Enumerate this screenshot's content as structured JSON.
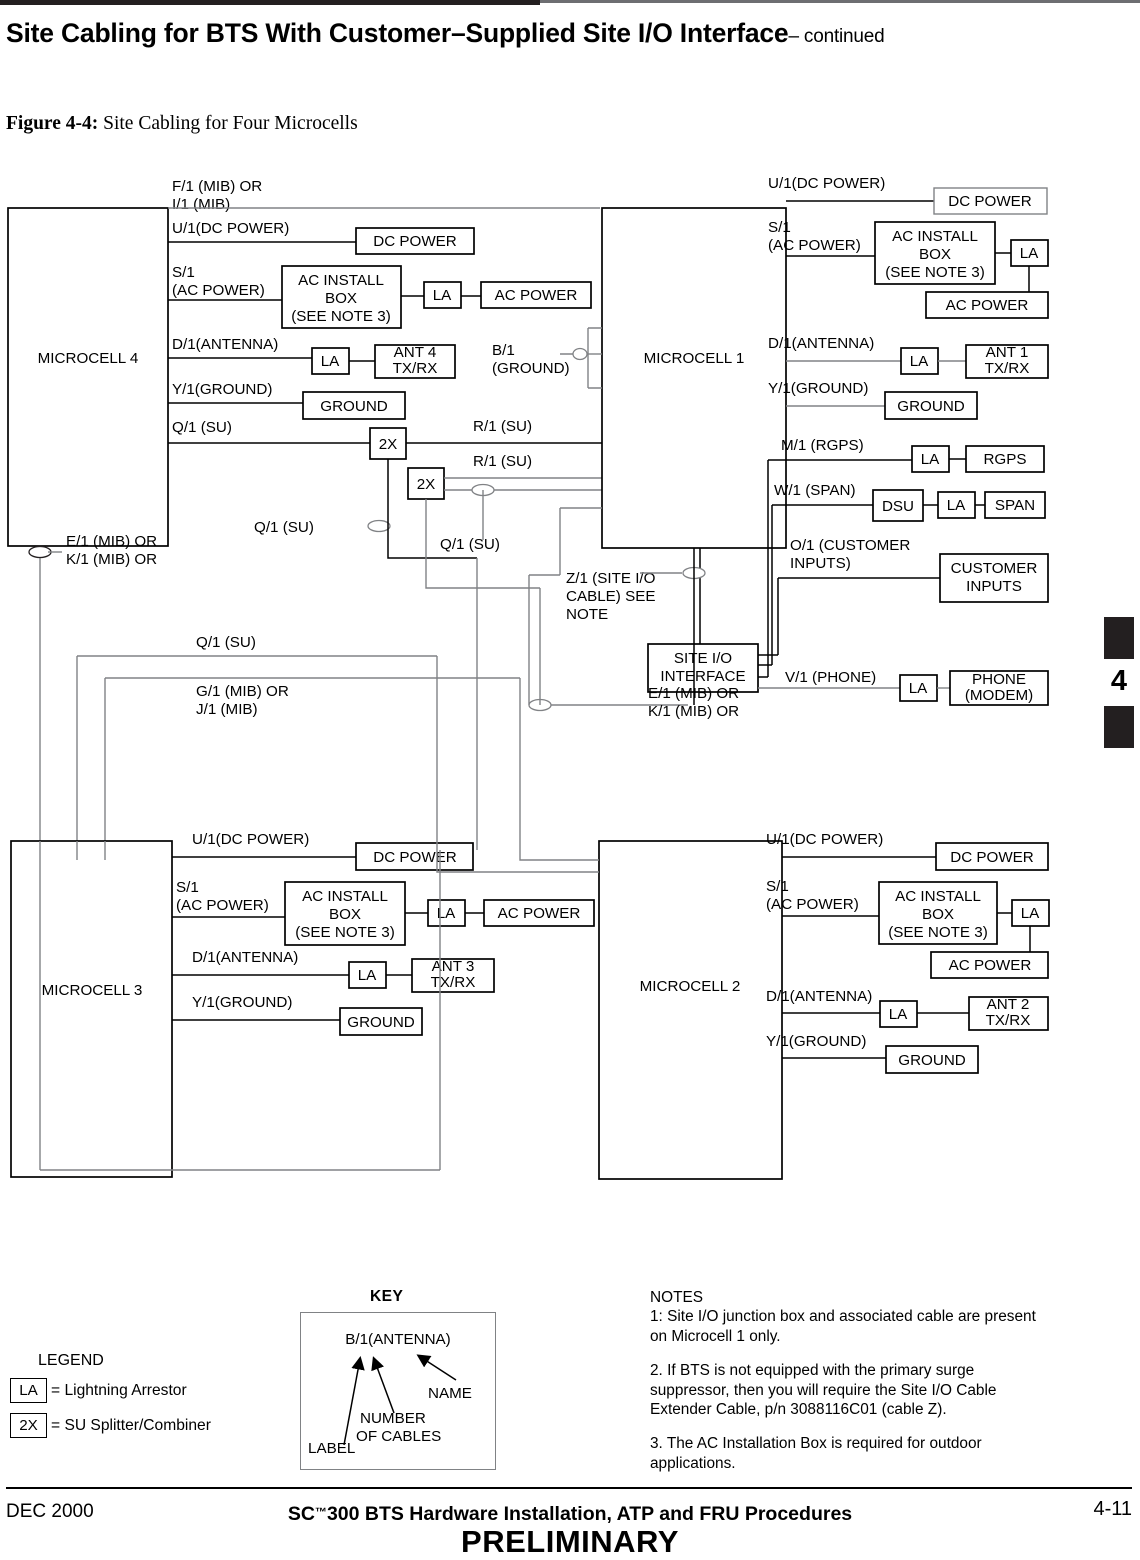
{
  "header": {
    "running_head": "Site Cabling for BTS With Customer–Supplied Site I/O Interface",
    "running_head_continued": "– continued"
  },
  "figure": {
    "number": "Figure 4-4:",
    "title": "Site Cabling for Four Microcells"
  },
  "chapter_tab": {
    "number": "4"
  },
  "diagram": {
    "microcell4": {
      "title": "MICROCELL 4",
      "top_label_line1": "F/1 (MIB) OR",
      "top_label_line2": "I/1 (MIB)",
      "bottom_label_line1": "E/1 (MIB) OR",
      "bottom_label_line2": "K/1 (MIB) OR",
      "ports": [
        {
          "label": "U/1(DC POWER)",
          "target": "DC POWER"
        },
        {
          "label_line1": "S/1",
          "label_line2": "(AC POWER)",
          "target": "AC INSTALL BOX (SEE NOTE 3)",
          "arrestor": "LA",
          "target2": "AC POWER"
        },
        {
          "label": "D/1(ANTENNA)",
          "arrestor": "LA",
          "target": "ANT 4 TX/RX"
        },
        {
          "label": "Y/1(GROUND)",
          "target": "GROUND"
        },
        {
          "label": "Q/1 (SU)",
          "splitter": "2X"
        }
      ],
      "ac_install_box_line1": "AC INSTALL",
      "ac_install_box_line2": "BOX",
      "ac_install_box_line3": "(SEE NOTE 3)",
      "ant_line1": "ANT 4",
      "ant_line2": "TX/RX"
    },
    "microcell1": {
      "title": "MICROCELL 1",
      "ports": [
        {
          "label": "U/1(DC POWER)",
          "target": "DC POWER"
        },
        {
          "label_line1": "S/1",
          "label_line2": "(AC POWER)",
          "target": "AC INSTALL BOX (SEE NOTE 3)",
          "arrestor": "LA",
          "target2": "AC POWER"
        },
        {
          "label": "D/1(ANTENNA)",
          "arrestor": "LA",
          "target": "ANT 1 TX/RX"
        },
        {
          "label": "Y/1(GROUND)",
          "target": "GROUND"
        },
        {
          "label": "M/1 (RGPS)",
          "arrestor": "LA",
          "target": "RGPS"
        },
        {
          "label": "W/1 (SPAN)",
          "dsu": "DSU",
          "arrestor": "LA",
          "target": "SPAN"
        },
        {
          "label_line1": "O/1 (CUSTOMER",
          "label_line2": "INPUTS)",
          "target": "CUSTOMER INPUTS"
        },
        {
          "label": "V/1 (PHONE)",
          "arrestor": "LA",
          "target": "PHONE (MODEM)"
        }
      ],
      "ant_line1": "ANT 1",
      "ant_line2": "TX/RX",
      "ground_label": "B/1",
      "ground_label2": "(GROUND)",
      "customer_inputs_line1": "CUSTOMER",
      "customer_inputs_line2": "INPUTS",
      "phone_line1": "PHONE",
      "phone_line2": "(MODEM)",
      "bottom_label_line1": "E/1 (MIB) OR",
      "bottom_label_line2": "K/1 (MIB) OR"
    },
    "microcell3": {
      "title": "MICROCELL 3",
      "ports": [
        {
          "label": "U/1(DC POWER)",
          "target": "DC POWER"
        },
        {
          "label_line1": "S/1",
          "label_line2": "(AC POWER)",
          "target": "AC INSTALL BOX (SEE NOTE 3)",
          "arrestor": "LA",
          "target2": "AC POWER"
        },
        {
          "label": "D/1(ANTENNA)",
          "arrestor": "LA",
          "target": "ANT 3 TX/RX"
        },
        {
          "label": "Y/1(GROUND)",
          "target": "GROUND"
        }
      ],
      "ant_line1": "ANT 3",
      "ant_line2": "TX/RX"
    },
    "microcell2": {
      "title": "MICROCELL 2",
      "ports": [
        {
          "label": "U/1(DC POWER)",
          "target": "DC POWER"
        },
        {
          "label_line1": "S/1",
          "label_line2": "(AC POWER)",
          "target": "AC INSTALL BOX (SEE NOTE 3)",
          "arrestor": "LA",
          "target2": "AC POWER"
        },
        {
          "label": "D/1(ANTENNA)",
          "arrestor": "LA",
          "target": "ANT 2 TX/RX"
        },
        {
          "label": "Y/1(GROUND)",
          "target": "GROUND"
        }
      ],
      "ant_line1": "ANT 2",
      "ant_line2": "TX/RX"
    },
    "site_io": {
      "box_line1": "SITE I/O",
      "box_line2": "INTERFACE",
      "cable_line1": "Z/1 (SITE I/O",
      "cable_line2": "CABLE) SEE",
      "cable_line3": "NOTE"
    },
    "common_labels": {
      "dc_power": "DC POWER",
      "ac_power": "AC POWER",
      "ground": "GROUND",
      "la": "LA",
      "splitter": "2X",
      "dsu": "DSU",
      "rgps": "RGPS",
      "span": "SPAN",
      "ac_install_1": "AC INSTALL",
      "ac_install_2": "BOX",
      "ac_install_3": "(SEE NOTE 3)"
    },
    "interconnect_labels": {
      "su_top": "Q/1 (SU)",
      "su_r1_a": "R/1 (SU)",
      "su_r1_b": "R/1 (SU)",
      "su_mid_left": "Q/1 (SU)",
      "su_mid_right": "Q/1 (SU)",
      "su_lower": "Q/1 (SU)",
      "mib_g_line1": "G/1 (MIB) OR",
      "mib_g_line2": "J/1 (MIB)"
    }
  },
  "legend": {
    "title": "LEGEND",
    "rows": [
      {
        "chip": "LA",
        "text": "= Lightning  Arrestor"
      },
      {
        "chip": "2X",
        "text": "=  SU Splitter/Combiner"
      }
    ]
  },
  "key": {
    "title": "KEY",
    "sample": "B/1(ANTENNA)",
    "label_text": "LABEL",
    "number_line1": "NUMBER",
    "number_line2": "OF CABLES",
    "name_text": "NAME"
  },
  "notes": {
    "title": "NOTES",
    "items": [
      "1:  Site I/O junction box and associated cable are present on Microcell 1 only.",
      "2.  If BTS is not equipped with the primary surge suppressor, then you will require the Site I/O Cable Extender Cable, p/n 3088116C01 (cable Z).",
      "3.  The AC Installation Box is required for outdoor applications."
    ]
  },
  "footer": {
    "date": "DEC 2000",
    "title_prefix": "SC",
    "title_tm": "™",
    "title_rest": "300 BTS Hardware Installation, ATP and FRU Procedures",
    "page": "4-11",
    "status": "PRELIMINARY"
  }
}
